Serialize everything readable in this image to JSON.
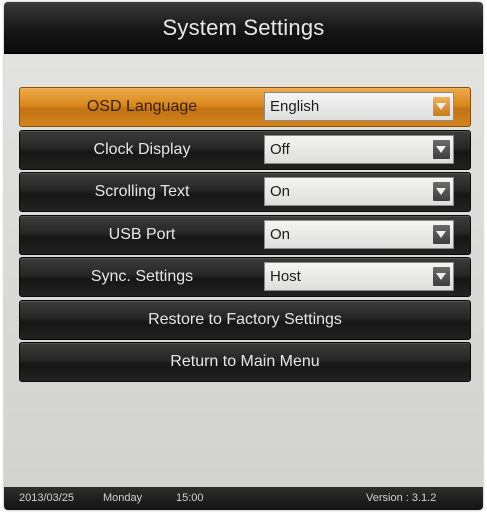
{
  "window": {
    "title": "System Settings"
  },
  "settings": [
    {
      "label": "OSD Language",
      "value": "English",
      "selected": true
    },
    {
      "label": "Clock Display",
      "value": "Off",
      "selected": false
    },
    {
      "label": "Scrolling Text",
      "value": "On",
      "selected": false
    },
    {
      "label": "USB Port",
      "value": "On",
      "selected": false
    },
    {
      "label": "Sync. Settings",
      "value": "Host",
      "selected": false
    }
  ],
  "actions": {
    "restore_label": "Restore to Factory Settings",
    "return_label": "Return to Main Menu"
  },
  "status": {
    "date": "2013/03/25",
    "day": "Monday",
    "time": "15:00",
    "version": "Version : 3.1.2"
  },
  "colors": {
    "accent": "#d98a1e",
    "bar": "#1a1a1a",
    "background": "#dcdcd8"
  },
  "icons": {
    "dropdown": "chevron-down-icon"
  }
}
